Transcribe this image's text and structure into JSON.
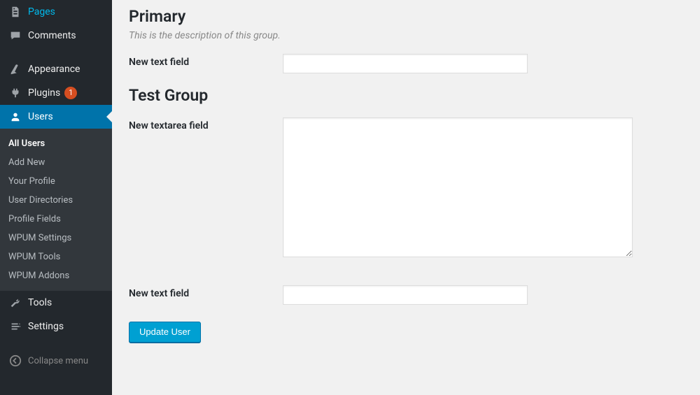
{
  "sidebar": {
    "items": [
      {
        "label": "Pages",
        "icon": "pages-icon"
      },
      {
        "label": "Comments",
        "icon": "comments-icon"
      }
    ],
    "items2": [
      {
        "label": "Appearance",
        "icon": "appearance-icon"
      },
      {
        "label": "Plugins",
        "icon": "plugins-icon",
        "badge": "1"
      },
      {
        "label": "Users",
        "icon": "users-icon",
        "active": true
      },
      {
        "label": "Tools",
        "icon": "tools-icon"
      },
      {
        "label": "Settings",
        "icon": "settings-icon"
      }
    ],
    "submenu": [
      {
        "label": "All Users",
        "current": true
      },
      {
        "label": "Add New"
      },
      {
        "label": "Your Profile"
      },
      {
        "label": "User Directories"
      },
      {
        "label": "Profile Fields"
      },
      {
        "label": "WPUM Settings"
      },
      {
        "label": "WPUM Tools"
      },
      {
        "label": "WPUM Addons"
      }
    ],
    "collapse_label": "Collapse menu"
  },
  "content": {
    "groups": [
      {
        "title": "Primary",
        "description": "This is the description of this group.",
        "fields": [
          {
            "label": "New text field",
            "type": "text",
            "value": ""
          }
        ]
      },
      {
        "title": "Test Group",
        "fields": [
          {
            "label": "New textarea field",
            "type": "textarea",
            "value": ""
          },
          {
            "label": "New text field",
            "type": "text",
            "value": ""
          }
        ]
      }
    ],
    "submit_label": "Update User"
  }
}
